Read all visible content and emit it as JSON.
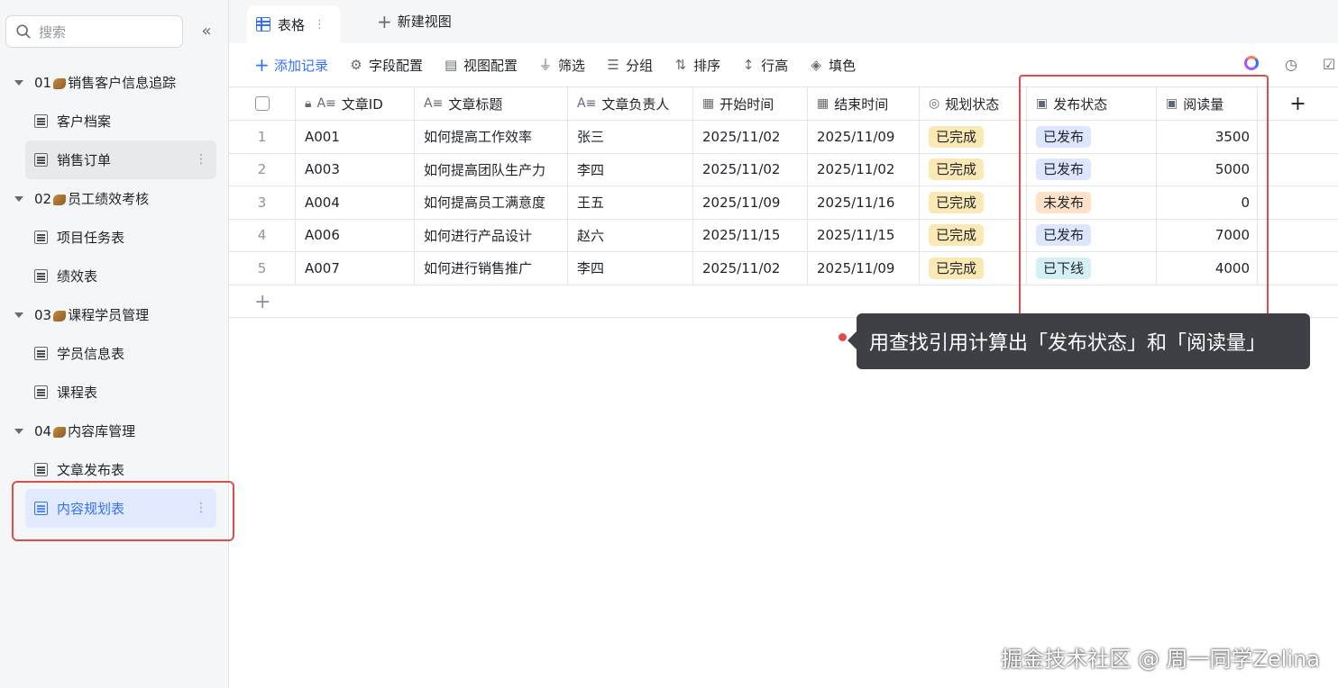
{
  "sidebar": {
    "search_placeholder": "搜索",
    "collapse": "«",
    "groups": [
      {
        "label_prefix": "01",
        "label": "销售客户信息追踪",
        "items": [
          "客户档案",
          "销售订单"
        ]
      },
      {
        "label_prefix": "02",
        "label": "员工绩效考核",
        "items": [
          "项目任务表",
          "绩效表"
        ]
      },
      {
        "label_prefix": "03",
        "label": "课程学员管理",
        "items": [
          "学员信息表",
          "课程表"
        ]
      },
      {
        "label_prefix": "04",
        "label": "内容库管理",
        "items": [
          "文章发布表",
          "内容规划表"
        ]
      }
    ]
  },
  "topbar": {
    "tab_label": "表格",
    "new_view_label": "新建视图"
  },
  "toolbar": {
    "add_record": "添加记录",
    "field_config": "字段配置",
    "view_config": "视图配置",
    "filter": "筛选",
    "group": "分组",
    "sort": "排序",
    "row_height": "行高",
    "fill_color": "填色"
  },
  "table": {
    "headers": [
      "文章ID",
      "文章标题",
      "文章负责人",
      "开始时间",
      "结束时间",
      "规划状态",
      "发布状态",
      "阅读量"
    ],
    "rows": [
      {
        "num": "1",
        "id": "A001",
        "title": "如何提高工作效率",
        "owner": "张三",
        "start": "2025/11/02",
        "end": "2025/11/09",
        "plan": "已完成",
        "publish": "已发布",
        "reads": "3500"
      },
      {
        "num": "2",
        "id": "A003",
        "title": "如何提高团队生产力",
        "owner": "李四",
        "start": "2025/11/02",
        "end": "2025/11/02",
        "plan": "已完成",
        "publish": "已发布",
        "reads": "5000"
      },
      {
        "num": "3",
        "id": "A004",
        "title": "如何提高员工满意度",
        "owner": "王五",
        "start": "2025/11/09",
        "end": "2025/11/16",
        "plan": "已完成",
        "publish": "未发布",
        "reads": "0"
      },
      {
        "num": "4",
        "id": "A006",
        "title": "如何进行产品设计",
        "owner": "赵六",
        "start": "2025/11/15",
        "end": "2025/11/15",
        "plan": "已完成",
        "publish": "已发布",
        "reads": "7000"
      },
      {
        "num": "5",
        "id": "A007",
        "title": "如何进行销售推广",
        "owner": "李四",
        "start": "2025/11/02",
        "end": "2025/11/09",
        "plan": "已完成",
        "publish": "已下线",
        "reads": "4000"
      }
    ]
  },
  "callout": "用查找引用计算出「发布状态」和「阅读量」",
  "watermark": "掘金技术社区 @ 周一同学Zelina",
  "colors": {
    "accent": "#3370ff",
    "highlight": "#e04c4c",
    "callout_bg": "#3f4045"
  }
}
